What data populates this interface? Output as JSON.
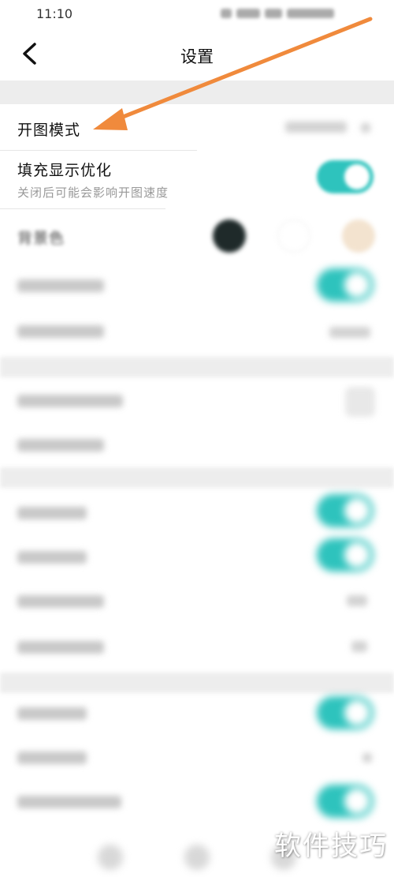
{
  "status_bar": {
    "time": "11:10"
  },
  "nav": {
    "title": "设置"
  },
  "settings": {
    "open_mode": {
      "label": "开图模式"
    },
    "fill_display": {
      "label": "填充显示优化",
      "subtitle": "关闭后可能会影响开图速度",
      "enabled": true
    },
    "background": {
      "label": "背景色",
      "colors": [
        "#1f2a2a",
        "#ffffff",
        "#f3e3cf"
      ]
    }
  },
  "colors": {
    "accent": "#2ec3bd",
    "arrow": "#f08a3c",
    "section_gap": "#ededed"
  },
  "watermark": "软件技巧"
}
